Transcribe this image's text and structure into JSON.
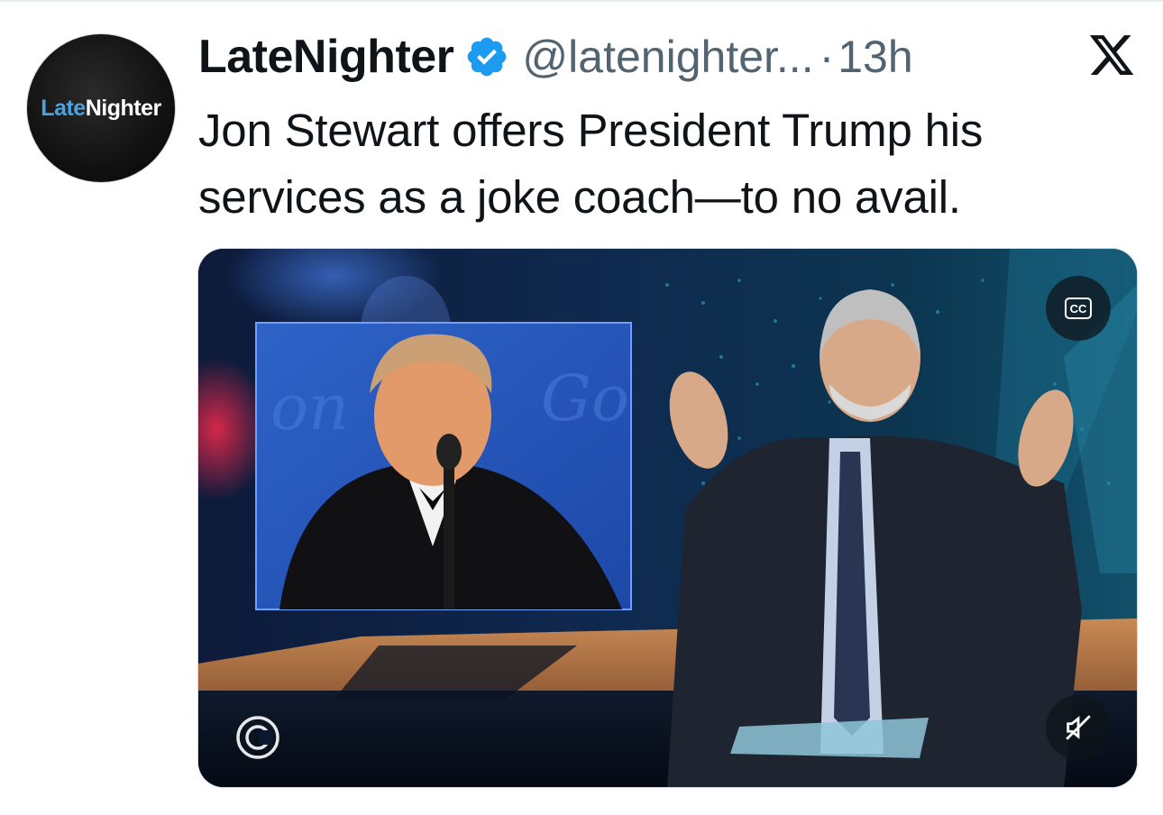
{
  "author": {
    "display_name": "LateNighter",
    "handle": "@latenighter...",
    "separator": "·",
    "time": "13h",
    "avatar_logo": {
      "part1": "Late",
      "part2": "Nighter"
    },
    "verified_icon": "verified-badge-icon"
  },
  "tweet": {
    "text_line1": "Jon Stewart offers President Trump his",
    "text_line2": "services as a joke coach—to no avail."
  },
  "media": {
    "cc_label": "CC",
    "icons": {
      "captions": "closed-captions-icon",
      "mute": "speaker-muted-icon",
      "network": "comedy-central-logo-icon"
    }
  },
  "platform_icon": "x-logo-icon",
  "colors": {
    "text_primary": "#0f1419",
    "text_secondary": "#536471",
    "verified_blue": "#1d9bf0",
    "logo_blue": "#4aa3e0"
  }
}
